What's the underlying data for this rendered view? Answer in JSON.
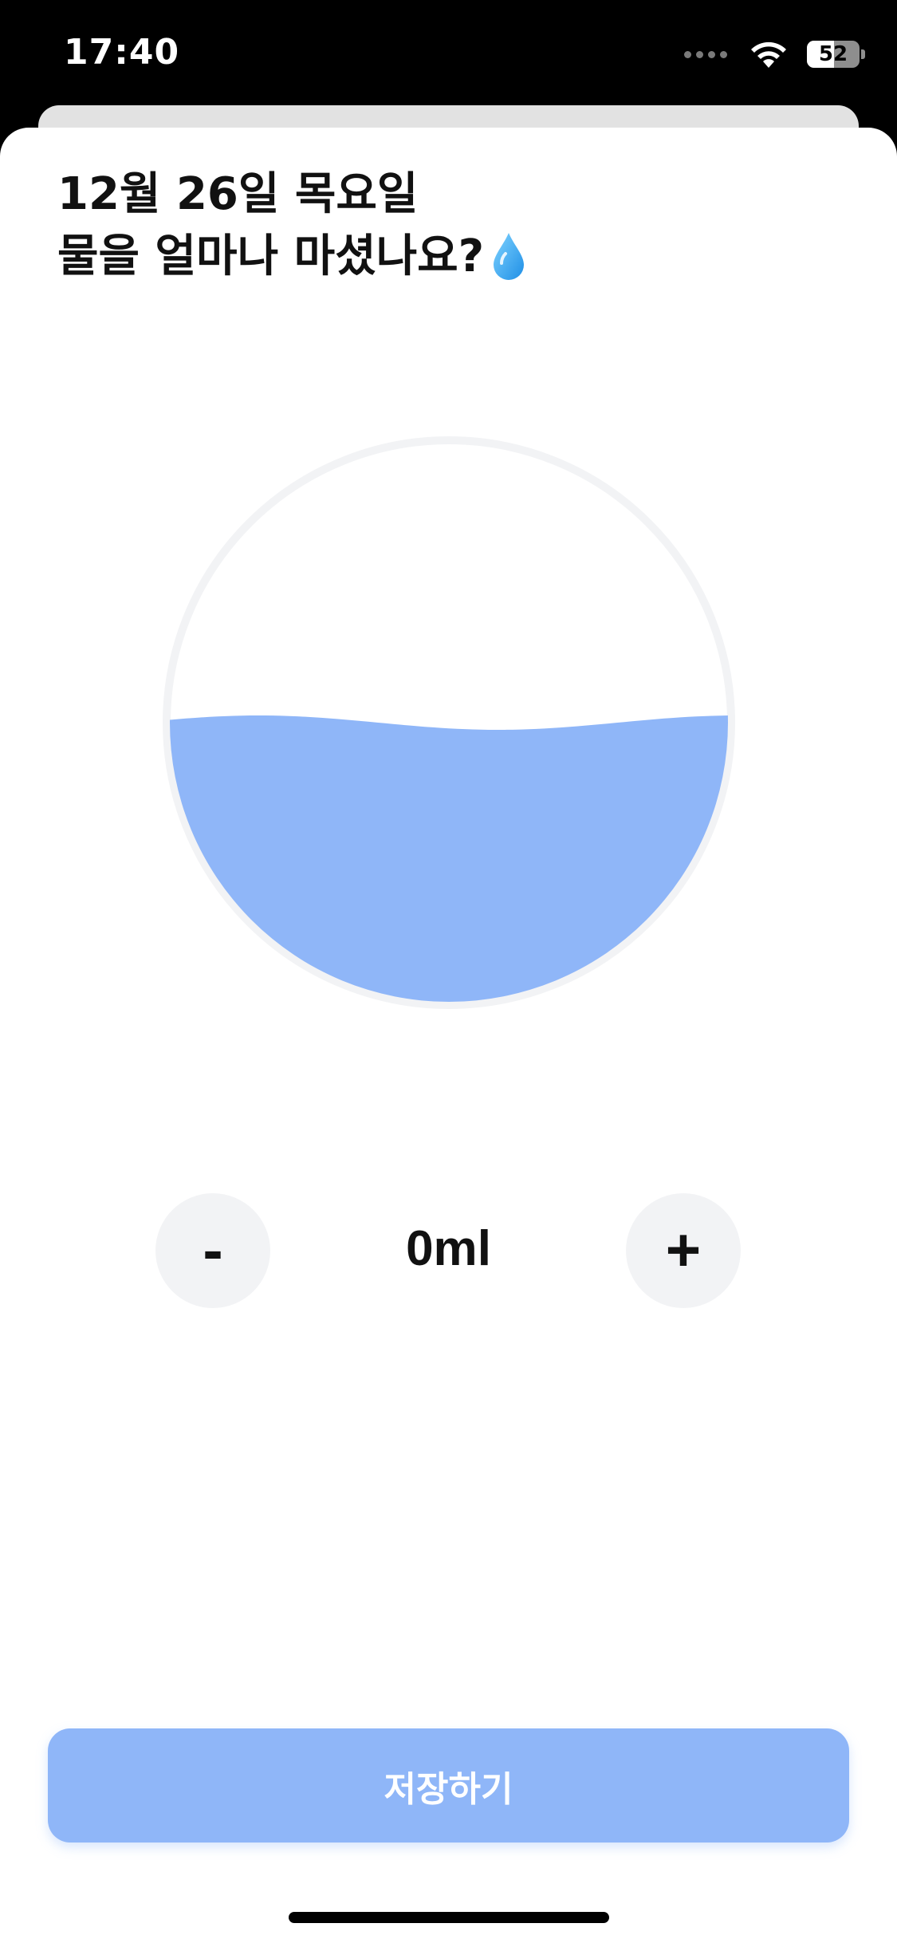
{
  "status_bar": {
    "time": "17:40",
    "battery_level": "52",
    "icons": [
      "signal-icon",
      "wifi-icon",
      "battery-icon"
    ]
  },
  "header": {
    "date_line": "12월 26일 목요일",
    "question_line": "물을 얼마나 마셨나요?",
    "icon": "water-drop-icon"
  },
  "water_gauge": {
    "fill_fraction": 0.5,
    "fill_color": "#8fb6f8",
    "ring_color": "#f2f3f5"
  },
  "controls": {
    "minus_label": "-",
    "plus_label": "+",
    "amount": "0ml"
  },
  "footer": {
    "save_label": "저장하기",
    "save_color": "#8fb6f8"
  }
}
